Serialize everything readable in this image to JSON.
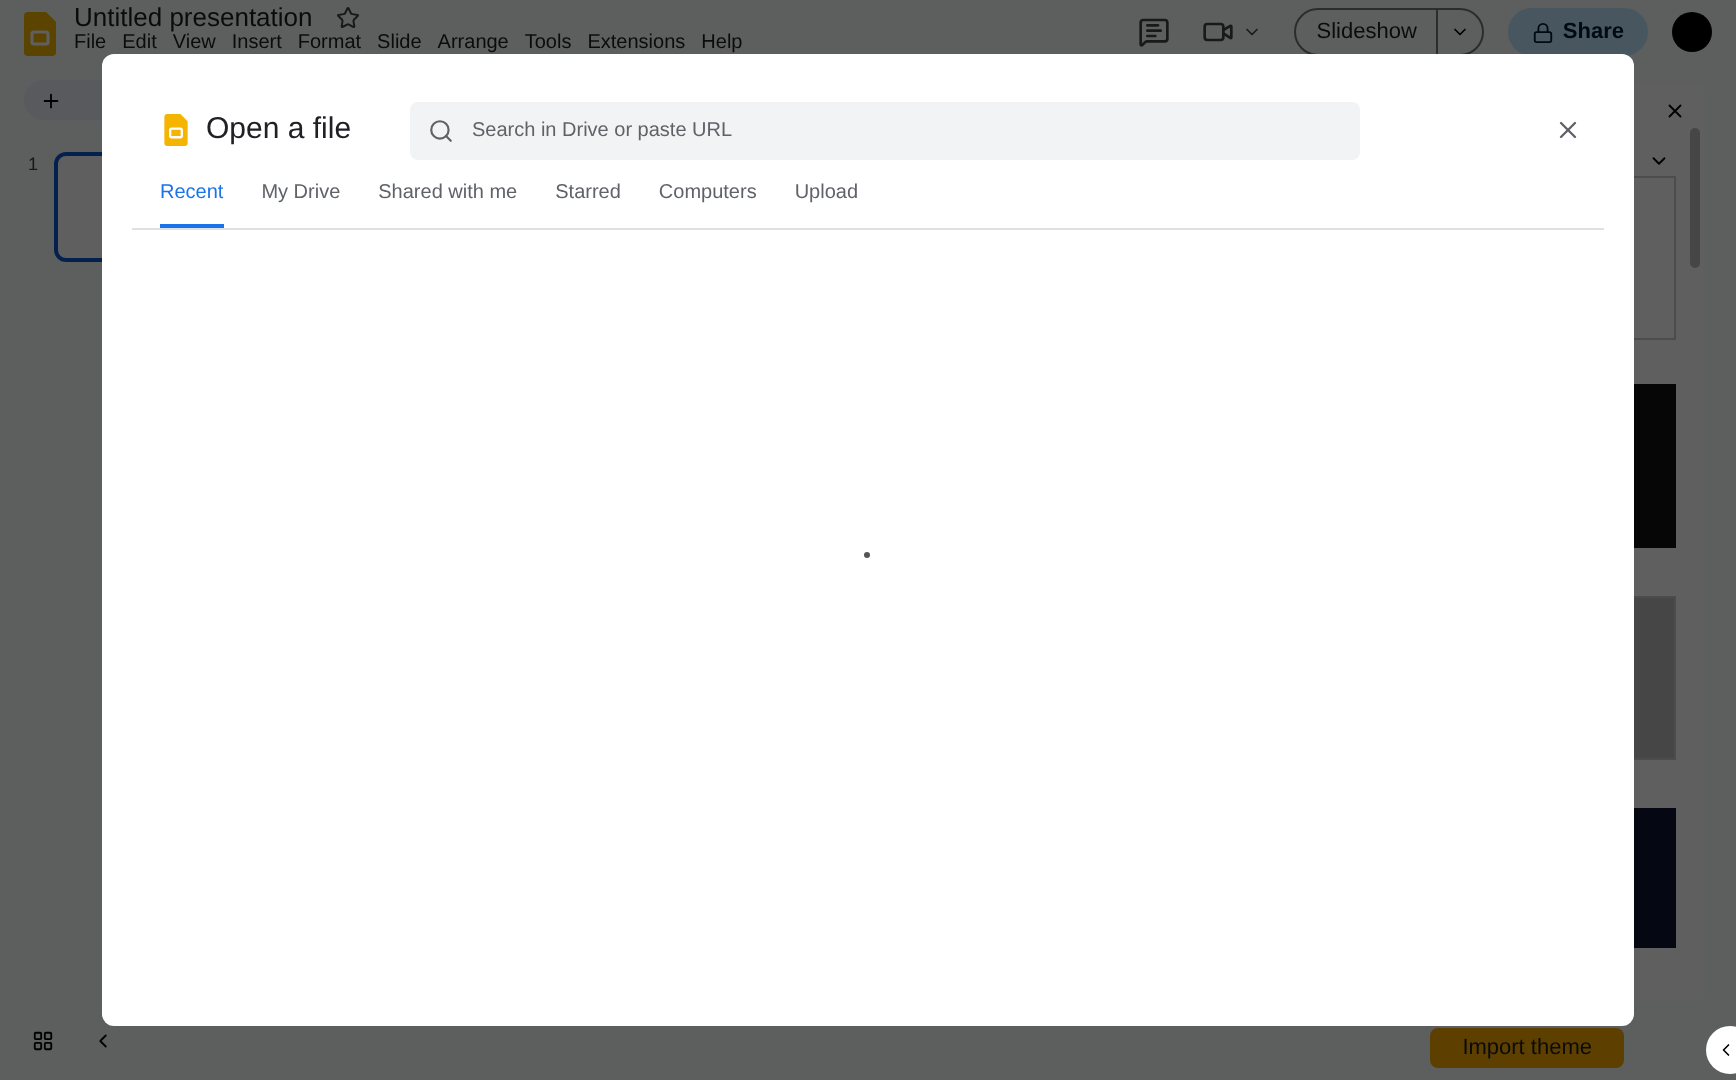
{
  "app": {
    "title": "Untitled presentation",
    "starred": false,
    "menu": [
      "File",
      "Edit",
      "View",
      "Insert",
      "Format",
      "Slide",
      "Arrange",
      "Tools",
      "Extensions",
      "Help"
    ],
    "slideshow_button": "Slideshow",
    "share_button": "Share",
    "slide_number": "1",
    "import_theme_button": "Import theme"
  },
  "dialog": {
    "title": "Open a file",
    "search": {
      "placeholder": "Search in Drive or paste URL"
    },
    "tabs": [
      {
        "label": "Recent",
        "selected": true
      },
      {
        "label": "My Drive",
        "selected": false
      },
      {
        "label": "Shared with me",
        "selected": false
      },
      {
        "label": "Starred",
        "selected": false
      },
      {
        "label": "Computers",
        "selected": false
      },
      {
        "label": "Upload",
        "selected": false
      }
    ],
    "loading": true
  }
}
